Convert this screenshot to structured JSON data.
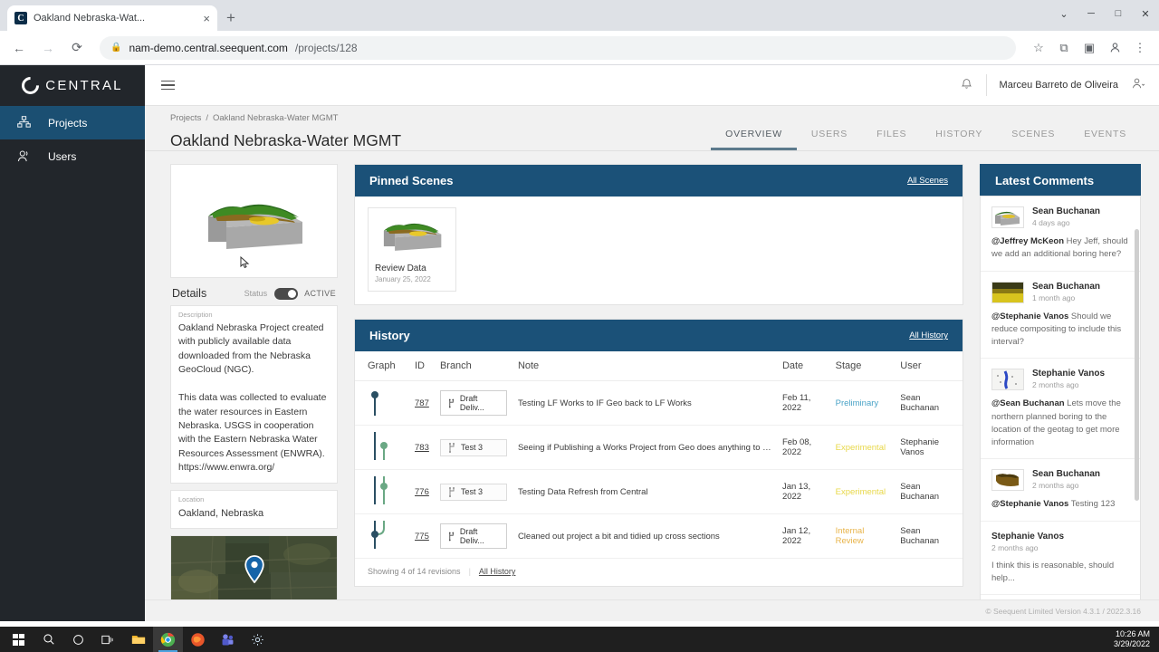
{
  "browser": {
    "tab_title": "Oakland Nebraska-Wat...",
    "tab_favicon": "C",
    "close_icon": "×",
    "newtab_icon": "+",
    "back_icon": "←",
    "forward_icon": "→",
    "reload_icon": "⟳",
    "lock_icon": "🔒",
    "url_main": "nam-demo.central.seequent.com",
    "url_path": "/projects/128",
    "star_icon": "☆",
    "ext_icon": "⧉",
    "split_icon": "▣",
    "profile_icon": "●",
    "menu_icon": "⋮",
    "win_min": "─",
    "win_max": "□",
    "win_close": "✕",
    "win_chevron": "⌄"
  },
  "sidebar": {
    "brand": "CENTRAL",
    "items": [
      {
        "label": "Projects",
        "icon": "projects-icon",
        "active": true
      },
      {
        "label": "Users",
        "icon": "users-icon",
        "active": false
      }
    ]
  },
  "topbar": {
    "hamburger": "menu-icon",
    "bell_icon": "🔔",
    "user_name": "Marceu Barreto de Oliveira",
    "user_icon": "user-avatar-icon"
  },
  "header": {
    "breadcrumb_root": "Projects",
    "breadcrumb_sep": "/",
    "breadcrumb_current": "Oakland Nebraska-Water MGMT",
    "title": "Oakland Nebraska-Water MGMT",
    "tabs": [
      {
        "label": "OVERVIEW",
        "selected": true
      },
      {
        "label": "USERS",
        "selected": false
      },
      {
        "label": "FILES",
        "selected": false
      },
      {
        "label": "HISTORY",
        "selected": false
      },
      {
        "label": "SCENES",
        "selected": false
      },
      {
        "label": "EVENTS",
        "selected": false
      }
    ]
  },
  "details": {
    "title": "Details",
    "status_label": "Status",
    "status_value": "ACTIVE",
    "description_label": "Description",
    "description_value": "Oakland Nebraska Project created with publicly available data downloaded from the Nebraska GeoCloud (NGC).\n\nThis data was collected to evaluate the water resources in Eastern Nebraska. USGS in cooperation with the Eastern Nebraska Water Resources Assessment (ENWRA). https://www.enwra.org/",
    "location_label": "Location",
    "location_value": "Oakland, Nebraska"
  },
  "pinned_scenes": {
    "title": "Pinned Scenes",
    "all_link": "All Scenes",
    "scenes": [
      {
        "name": "Review Data",
        "date": "January 25, 2022"
      }
    ]
  },
  "history": {
    "title": "History",
    "all_link": "All History",
    "columns": [
      "Graph",
      "ID",
      "Branch",
      "Note",
      "Date",
      "Stage",
      "User"
    ],
    "rows": [
      {
        "id": "787",
        "branch": "Draft Deliv...",
        "note": "Testing LF Works to IF Geo back to LF Works",
        "date": "Feb 11, 2022",
        "stage": "Preliminary",
        "stage_color": "#4aa3c7",
        "user": "Sean Buchanan"
      },
      {
        "id": "783",
        "branch": "Test 3",
        "note": "Seeing if Publishing a Works Project from Geo does anything to the proje...",
        "date": "Feb 08, 2022",
        "stage": "Experimental",
        "stage_color": "#e8d84a",
        "user": "Stephanie Vanos"
      },
      {
        "id": "776",
        "branch": "Test 3",
        "note": "Testing Data Refresh from Central",
        "date": "Jan 13, 2022",
        "stage": "Experimental",
        "stage_color": "#e8d84a",
        "user": "Sean Buchanan"
      },
      {
        "id": "775",
        "branch": "Draft Deliv...",
        "note": "Cleaned out project a bit and tidied up cross sections",
        "date": "Jan 12, 2022",
        "stage": "Internal Review",
        "stage_color": "#e8b44a",
        "user": "Sean Buchanan"
      }
    ],
    "footer_text": "Showing 4 of 14 revisions",
    "footer_sep": "|",
    "footer_link": "All History"
  },
  "comments": {
    "title": "Latest Comments",
    "items": [
      {
        "author": "Sean Buchanan",
        "time": "4 days ago",
        "mention": "@Jeffrey McKeon",
        "text": " Hey Jeff, should we add an additional boring here?",
        "avatar": "scene-thumb-brown",
        "has_avatar": true
      },
      {
        "author": "Sean Buchanan",
        "time": "1 month ago",
        "mention": "@Stephanie Vanos",
        "text": " Should we reduce compositing to include this interval?",
        "avatar": "scene-thumb-yellow",
        "has_avatar": true
      },
      {
        "author": "Stephanie Vanos",
        "time": "2 months ago",
        "mention": "@Sean Buchanan",
        "text": " Lets move the northern planned boring to the location of the geotag to get more information",
        "avatar": "scene-thumb-map",
        "has_avatar": true
      },
      {
        "author": "Sean Buchanan",
        "time": "2 months ago",
        "mention": "@Stephanie Vanos",
        "text": " Testing 123",
        "avatar": "scene-thumb-dark",
        "has_avatar": true
      },
      {
        "author": "Stephanie Vanos",
        "time": "2 months ago",
        "mention": "",
        "text": "I think this is reasonable, should help...",
        "avatar": "",
        "has_avatar": false
      }
    ]
  },
  "footer": {
    "text": "© Seequent Limited    Version 4.3.1 / 2022.3.16"
  },
  "taskbar": {
    "time": "10:26 AM",
    "date": "3/29/2022",
    "items": [
      "start-icon",
      "search-icon",
      "cortana-icon",
      "task-view-icon",
      "file-explorer-icon",
      "chrome-icon",
      "firefox-icon",
      "teams-icon",
      "settings-icon"
    ]
  },
  "colors": {
    "panel_header": "#1b5178",
    "sidebar": "#22262b",
    "sidebar_active": "#1b4f72"
  }
}
